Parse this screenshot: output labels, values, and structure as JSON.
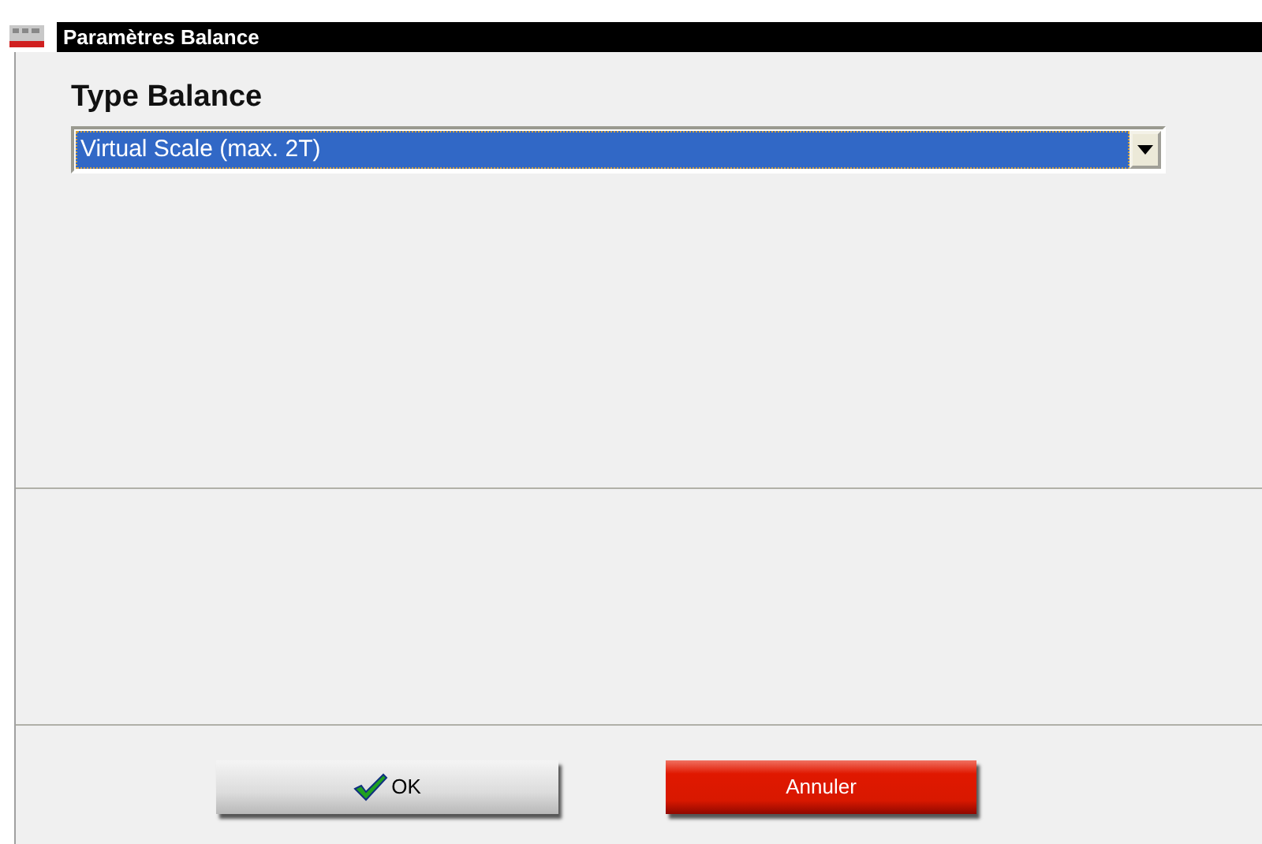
{
  "window": {
    "title": "Paramètres Balance"
  },
  "scale_type": {
    "label": "Type Balance",
    "value": "Virtual Scale (max. 2T)",
    "focused": true
  },
  "buttons": [
    {
      "kind": "ok",
      "label": "OK"
    },
    {
      "kind": "cancel",
      "label": "Annuler"
    }
  ]
}
